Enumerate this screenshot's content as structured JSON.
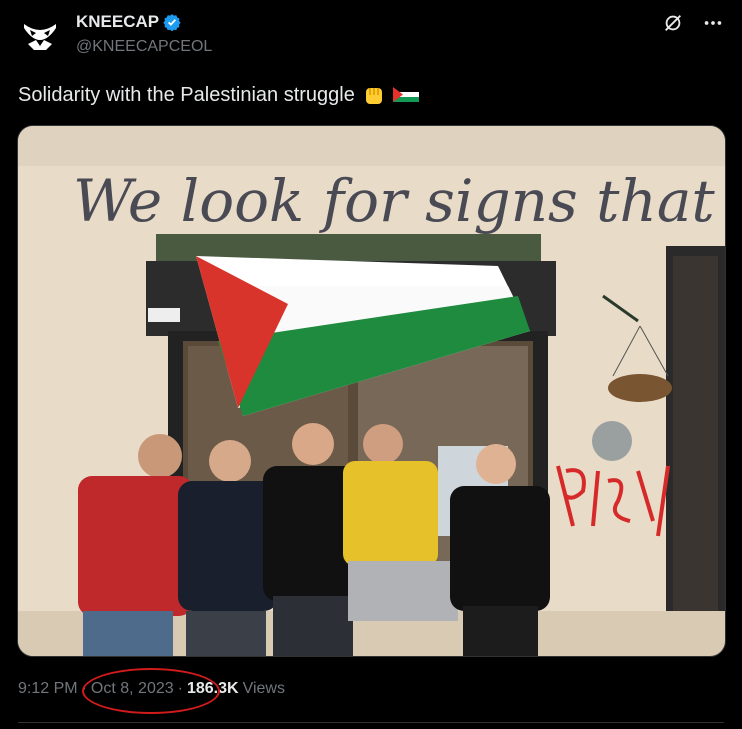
{
  "user": {
    "name": "KNEECAP",
    "handle": "@KNEECAPCEOL"
  },
  "tweet": {
    "text": "Solidarity with the Palestinian struggle"
  },
  "photo": {
    "wall_text": "We look for signs that"
  },
  "meta": {
    "time": "9:12 PM",
    "sep1": "·",
    "date": "Oct 8, 2023",
    "sep2": "·",
    "views_count": "186.3K",
    "views_label": "Views"
  },
  "colors": {
    "accent": "#1d9bf0",
    "annotation": "#d21b1b"
  }
}
